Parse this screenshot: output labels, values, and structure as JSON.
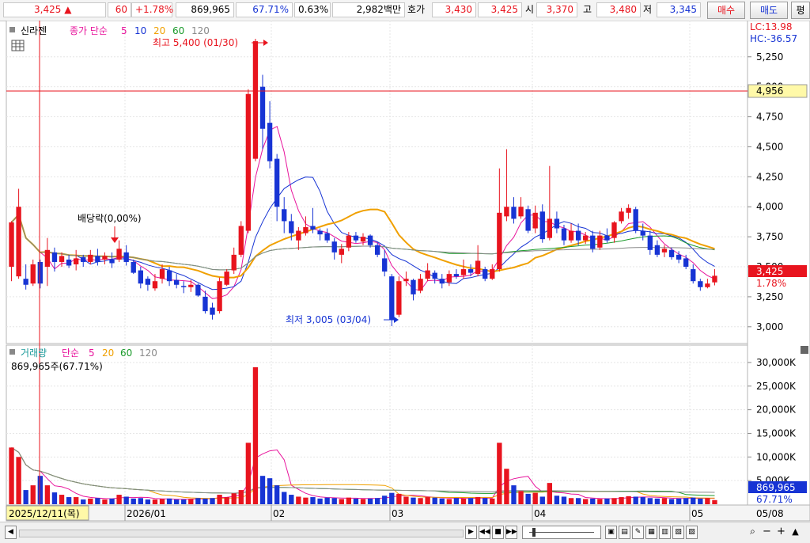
{
  "quote": {
    "price": "3,425",
    "change_arrow": "▲",
    "change": "60",
    "change_pct": "+1.78%",
    "volume": "869,965",
    "volume_ratio": "67.71%",
    "turnover": "0.63%",
    "amount": "2,982백만",
    "bid_label": "호가",
    "ask_price": "3,430",
    "bid_price": "3,425",
    "open_label": "시",
    "open": "3,370",
    "high_label": "고",
    "high": "3,480",
    "low_label": "저",
    "low": "3,345",
    "buy_button": "매수",
    "sell_button": "매도",
    "extra_button": "평"
  },
  "price_panel": {
    "toolbar_left": "신라젠",
    "indicator_label": "종가 단순",
    "ma_periods": [
      "5",
      "10",
      "20",
      "60",
      "120"
    ],
    "ma_colors": [
      "#e8149c",
      "#1734d4",
      "#f0a000",
      "#1a9a2a",
      "#8a8a8a"
    ],
    "high_annotation": "최고 5,400 (01/30)",
    "low_annotation": "최저 3,005 (03/04)",
    "dividend_annotation": "배당락(0,00%)",
    "lc_label": "LC:13.98",
    "hc_label": "HC:-36.57",
    "y_ticks": [
      "5,250",
      "5,000",
      "4,750",
      "4,500",
      "4,250",
      "4,000",
      "3,750",
      "3,500",
      "3,250",
      "3,000"
    ],
    "crosshair_value": "4,956",
    "current_price_tag": "3,425",
    "current_change_tag": "1.78%"
  },
  "volume_panel": {
    "title": "거래량",
    "indicator_label": "단순",
    "ma_periods": [
      "5",
      "20",
      "60",
      "120"
    ],
    "volume_text": "869,965주(67.71%)",
    "y_ticks": [
      "30,000K",
      "25,000K",
      "20,000K",
      "15,000K",
      "10,000K",
      "5,000K"
    ],
    "current_volume_tag": "869,965",
    "current_ratio_tag": "67.71%"
  },
  "x_axis": {
    "cursor_date": "2025/12/11(목)",
    "labels": [
      "2026/01",
      "02",
      "03",
      "04",
      "05",
      "05/08"
    ]
  },
  "colors": {
    "up": "#e8141e",
    "down": "#1734d4",
    "ma5": "#e8149c",
    "ma10": "#1734d4",
    "ma20": "#f0a000",
    "ma60": "#1a9a2a",
    "ma120": "#8a8a8a"
  },
  "chart_data": {
    "type": "candlestick",
    "y_range": [
      2880,
      5420
    ],
    "candles": [
      {
        "o": 3500,
        "h": 3880,
        "l": 3380,
        "c": 3870
      },
      {
        "o": 3420,
        "h": 4150,
        "l": 3400,
        "c": 4000
      },
      {
        "o": 3400,
        "h": 3520,
        "l": 3310,
        "c": 3350
      },
      {
        "o": 3360,
        "h": 3560,
        "l": 3340,
        "c": 3520
      },
      {
        "o": 3540,
        "h": 3560,
        "l": 3320,
        "c": 3360
      },
      {
        "o": 3500,
        "h": 3740,
        "l": 3340,
        "c": 3640
      },
      {
        "o": 3620,
        "h": 3660,
        "l": 3460,
        "c": 3540
      },
      {
        "o": 3540,
        "h": 3620,
        "l": 3500,
        "c": 3590
      },
      {
        "o": 3560,
        "h": 3600,
        "l": 3490,
        "c": 3510
      },
      {
        "o": 3520,
        "h": 3640,
        "l": 3470,
        "c": 3570
      },
      {
        "o": 3580,
        "h": 3600,
        "l": 3500,
        "c": 3540
      },
      {
        "o": 3540,
        "h": 3640,
        "l": 3520,
        "c": 3600
      },
      {
        "o": 3590,
        "h": 3650,
        "l": 3510,
        "c": 3540
      },
      {
        "o": 3560,
        "h": 3620,
        "l": 3520,
        "c": 3590
      },
      {
        "o": 3560,
        "h": 3620,
        "l": 3490,
        "c": 3530
      },
      {
        "o": 3560,
        "h": 3720,
        "l": 3540,
        "c": 3650
      },
      {
        "o": 3620,
        "h": 3680,
        "l": 3510,
        "c": 3540
      },
      {
        "o": 3540,
        "h": 3560,
        "l": 3440,
        "c": 3450
      },
      {
        "o": 3470,
        "h": 3500,
        "l": 3320,
        "c": 3360
      },
      {
        "o": 3400,
        "h": 3420,
        "l": 3300,
        "c": 3350
      },
      {
        "o": 3320,
        "h": 3440,
        "l": 3300,
        "c": 3380
      },
      {
        "o": 3400,
        "h": 3520,
        "l": 3360,
        "c": 3480
      },
      {
        "o": 3470,
        "h": 3500,
        "l": 3340,
        "c": 3380
      },
      {
        "o": 3390,
        "h": 3440,
        "l": 3320,
        "c": 3350
      },
      {
        "o": 3340,
        "h": 3380,
        "l": 3280,
        "c": 3330
      },
      {
        "o": 3330,
        "h": 3390,
        "l": 3290,
        "c": 3350
      },
      {
        "o": 3350,
        "h": 3360,
        "l": 3250,
        "c": 3260
      },
      {
        "o": 3250,
        "h": 3300,
        "l": 3110,
        "c": 3130
      },
      {
        "o": 3160,
        "h": 3200,
        "l": 3060,
        "c": 3100
      },
      {
        "o": 3130,
        "h": 3410,
        "l": 3110,
        "c": 3380
      },
      {
        "o": 3350,
        "h": 3480,
        "l": 3340,
        "c": 3460
      },
      {
        "o": 3470,
        "h": 3660,
        "l": 3440,
        "c": 3600
      },
      {
        "o": 3600,
        "h": 3880,
        "l": 3580,
        "c": 3840
      },
      {
        "o": 3800,
        "h": 4980,
        "l": 3780,
        "c": 4940
      },
      {
        "o": 4400,
        "h": 5400,
        "l": 4380,
        "c": 5380
      },
      {
        "o": 5000,
        "h": 5100,
        "l": 4480,
        "c": 4650
      },
      {
        "o": 4700,
        "h": 4880,
        "l": 4320,
        "c": 4380
      },
      {
        "o": 4400,
        "h": 4440,
        "l": 3880,
        "c": 4000
      },
      {
        "o": 3980,
        "h": 4080,
        "l": 3780,
        "c": 3880
      },
      {
        "o": 3880,
        "h": 3940,
        "l": 3720,
        "c": 3780
      },
      {
        "o": 3720,
        "h": 3830,
        "l": 3640,
        "c": 3800
      },
      {
        "o": 3780,
        "h": 3920,
        "l": 3760,
        "c": 3830
      },
      {
        "o": 3840,
        "h": 3990,
        "l": 3780,
        "c": 3810
      },
      {
        "o": 3800,
        "h": 3820,
        "l": 3720,
        "c": 3770
      },
      {
        "o": 3780,
        "h": 3820,
        "l": 3700,
        "c": 3720
      },
      {
        "o": 3710,
        "h": 3740,
        "l": 3560,
        "c": 3620
      },
      {
        "o": 3600,
        "h": 3690,
        "l": 3530,
        "c": 3650
      },
      {
        "o": 3660,
        "h": 3790,
        "l": 3630,
        "c": 3760
      },
      {
        "o": 3760,
        "h": 3790,
        "l": 3700,
        "c": 3720
      },
      {
        "o": 3710,
        "h": 3780,
        "l": 3680,
        "c": 3750
      },
      {
        "o": 3760,
        "h": 3770,
        "l": 3660,
        "c": 3680
      },
      {
        "o": 3680,
        "h": 3700,
        "l": 3580,
        "c": 3600
      },
      {
        "o": 3570,
        "h": 3640,
        "l": 3420,
        "c": 3460
      },
      {
        "o": 3420,
        "h": 3440,
        "l": 3005,
        "c": 3060
      },
      {
        "o": 3100,
        "h": 3420,
        "l": 3080,
        "c": 3380
      },
      {
        "o": 3380,
        "h": 3460,
        "l": 3340,
        "c": 3400
      },
      {
        "o": 3390,
        "h": 3400,
        "l": 3220,
        "c": 3270
      },
      {
        "o": 3300,
        "h": 3440,
        "l": 3280,
        "c": 3400
      },
      {
        "o": 3400,
        "h": 3530,
        "l": 3380,
        "c": 3470
      },
      {
        "o": 3450,
        "h": 3470,
        "l": 3360,
        "c": 3400
      },
      {
        "o": 3400,
        "h": 3440,
        "l": 3320,
        "c": 3360
      },
      {
        "o": 3370,
        "h": 3470,
        "l": 3340,
        "c": 3440
      },
      {
        "o": 3440,
        "h": 3480,
        "l": 3400,
        "c": 3420
      },
      {
        "o": 3430,
        "h": 3560,
        "l": 3400,
        "c": 3480
      },
      {
        "o": 3480,
        "h": 3520,
        "l": 3420,
        "c": 3450
      },
      {
        "o": 3440,
        "h": 3680,
        "l": 3420,
        "c": 3550
      },
      {
        "o": 3480,
        "h": 3500,
        "l": 3380,
        "c": 3400
      },
      {
        "o": 3400,
        "h": 3520,
        "l": 3390,
        "c": 3480
      },
      {
        "o": 3480,
        "h": 4320,
        "l": 3460,
        "c": 3950
      },
      {
        "o": 3920,
        "h": 4480,
        "l": 3880,
        "c": 4000
      },
      {
        "o": 4000,
        "h": 4080,
        "l": 3860,
        "c": 3900
      },
      {
        "o": 3920,
        "h": 4080,
        "l": 3900,
        "c": 4000
      },
      {
        "o": 3980,
        "h": 4010,
        "l": 3780,
        "c": 3800
      },
      {
        "o": 3820,
        "h": 4010,
        "l": 3780,
        "c": 3950
      },
      {
        "o": 3960,
        "h": 4020,
        "l": 3700,
        "c": 3730
      },
      {
        "o": 3740,
        "h": 4340,
        "l": 3720,
        "c": 3900
      },
      {
        "o": 3900,
        "h": 3960,
        "l": 3780,
        "c": 3820
      },
      {
        "o": 3820,
        "h": 3850,
        "l": 3680,
        "c": 3720
      },
      {
        "o": 3720,
        "h": 3860,
        "l": 3700,
        "c": 3800
      },
      {
        "o": 3800,
        "h": 3860,
        "l": 3680,
        "c": 3720
      },
      {
        "o": 3720,
        "h": 3790,
        "l": 3690,
        "c": 3760
      },
      {
        "o": 3760,
        "h": 3800,
        "l": 3620,
        "c": 3650
      },
      {
        "o": 3660,
        "h": 3800,
        "l": 3640,
        "c": 3760
      },
      {
        "o": 3760,
        "h": 3820,
        "l": 3700,
        "c": 3720
      },
      {
        "o": 3740,
        "h": 3880,
        "l": 3700,
        "c": 3870
      },
      {
        "o": 3880,
        "h": 3990,
        "l": 3860,
        "c": 3960
      },
      {
        "o": 3950,
        "h": 4020,
        "l": 3900,
        "c": 3990
      },
      {
        "o": 3980,
        "h": 4000,
        "l": 3780,
        "c": 3800
      },
      {
        "o": 3800,
        "h": 3860,
        "l": 3720,
        "c": 3760
      },
      {
        "o": 3760,
        "h": 3800,
        "l": 3600,
        "c": 3640
      },
      {
        "o": 3680,
        "h": 3720,
        "l": 3580,
        "c": 3600
      },
      {
        "o": 3620,
        "h": 3680,
        "l": 3580,
        "c": 3650
      },
      {
        "o": 3640,
        "h": 3660,
        "l": 3560,
        "c": 3580
      },
      {
        "o": 3600,
        "h": 3630,
        "l": 3530,
        "c": 3560
      },
      {
        "o": 3570,
        "h": 3600,
        "l": 3480,
        "c": 3500
      },
      {
        "o": 3480,
        "h": 3520,
        "l": 3360,
        "c": 3380
      },
      {
        "o": 3380,
        "h": 3400,
        "l": 3300,
        "c": 3330
      },
      {
        "o": 3330,
        "h": 3400,
        "l": 3320,
        "c": 3360
      },
      {
        "o": 3370,
        "h": 3480,
        "l": 3345,
        "c": 3425
      }
    ],
    "volume": [
      12,
      10,
      3,
      4,
      6,
      4,
      2.5,
      2,
      1.5,
      1.5,
      1,
      1.2,
      1.3,
      1,
      1.2,
      2,
      1.6,
      1.2,
      1.3,
      1,
      1,
      1.1,
      1.2,
      1,
      1,
      1.1,
      1.3,
      1.2,
      1.3,
      2,
      1.5,
      2.3,
      3,
      13,
      29,
      6,
      5.5,
      4,
      2.6,
      2,
      1.6,
      1.4,
      1.5,
      1.2,
      1.4,
      1.3,
      1.1,
      1.4,
      1.2,
      1.1,
      1.2,
      1.3,
      1.8,
      2.4,
      2.2,
      1.6,
      1.4,
      1.3,
      1.5,
      1.4,
      1.2,
      1.1,
      1.3,
      1.2,
      1.3,
      1.5,
      1.3,
      1.2,
      13,
      7.5,
      4,
      2.8,
      2.2,
      2.4,
      1.6,
      4.5,
      1.8,
      1.6,
      1.3,
      1.3,
      1.1,
      1.2,
      1.1,
      1.2,
      1.3,
      1.5,
      1.7,
      1.6,
      1.5,
      1.3,
      1.2,
      1.3,
      1.1,
      1.2,
      1.3,
      1.4,
      1.2,
      1.3,
      0.87
    ]
  }
}
